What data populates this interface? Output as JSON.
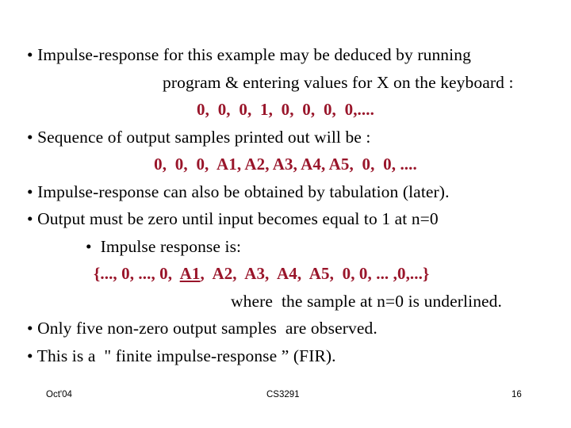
{
  "slide": {
    "background_color": "#ffffff",
    "body_text_color": "#000000",
    "accent_color": "#99152a",
    "bullet_glyph": "•"
  },
  "content": {
    "lines": [
      {
        "id": "bullet-impulse-response-deduced",
        "text": "• Impulse-response for this example may be deduced by running",
        "style": "black"
      },
      {
        "id": "continuation-program-entering-values",
        "text": "program & entering values for X on the keyboard :",
        "style": "black"
      },
      {
        "id": "input-sequence-values",
        "text": "0,  0,  0,  1,  0,  0,  0,  0,....",
        "style": "red"
      },
      {
        "id": "bullet-sequence-of-output-samples",
        "text": "• Sequence of output samples printed out will be :",
        "style": "black"
      },
      {
        "id": "output-sequence-values",
        "text": "0,  0,  0,  A1, A2, A3, A4, A5,  0,  0, ....",
        "style": "red"
      },
      {
        "id": "bullet-impulse-response-tabulation",
        "text": "• Impulse-response can also be obtained by tabulation (later).",
        "style": "black"
      },
      {
        "id": "bullet-output-must-be-zero",
        "text": "• Output must be zero until input becomes equal to 1 at n=0",
        "style": "black"
      },
      {
        "id": "bullet-impulse-response-is",
        "text": "•  Impulse response is:",
        "style": "black"
      },
      {
        "id": "impulse-response-set-notation",
        "prefix": "{..., 0, ..., 0,  ",
        "underlined": "A1",
        "suffix": ",  A2,  A3,  A4,  A5,  0, 0, ... ,0,...}",
        "style": "red"
      },
      {
        "id": "note-underlined-sample",
        "text": "where  the sample at n=0 is underlined.",
        "style": "black"
      },
      {
        "id": "bullet-only-five-non-zero",
        "text": "• Only five non-zero output samples  are observed.",
        "style": "black"
      },
      {
        "id": "bullet-finite-impulse-response",
        "text": "• This is a  \" finite impulse-response ” (FIR).",
        "style": "black"
      }
    ]
  },
  "footer": {
    "date": "Oct'04",
    "course_code": "CS3291",
    "page_number": "16"
  }
}
